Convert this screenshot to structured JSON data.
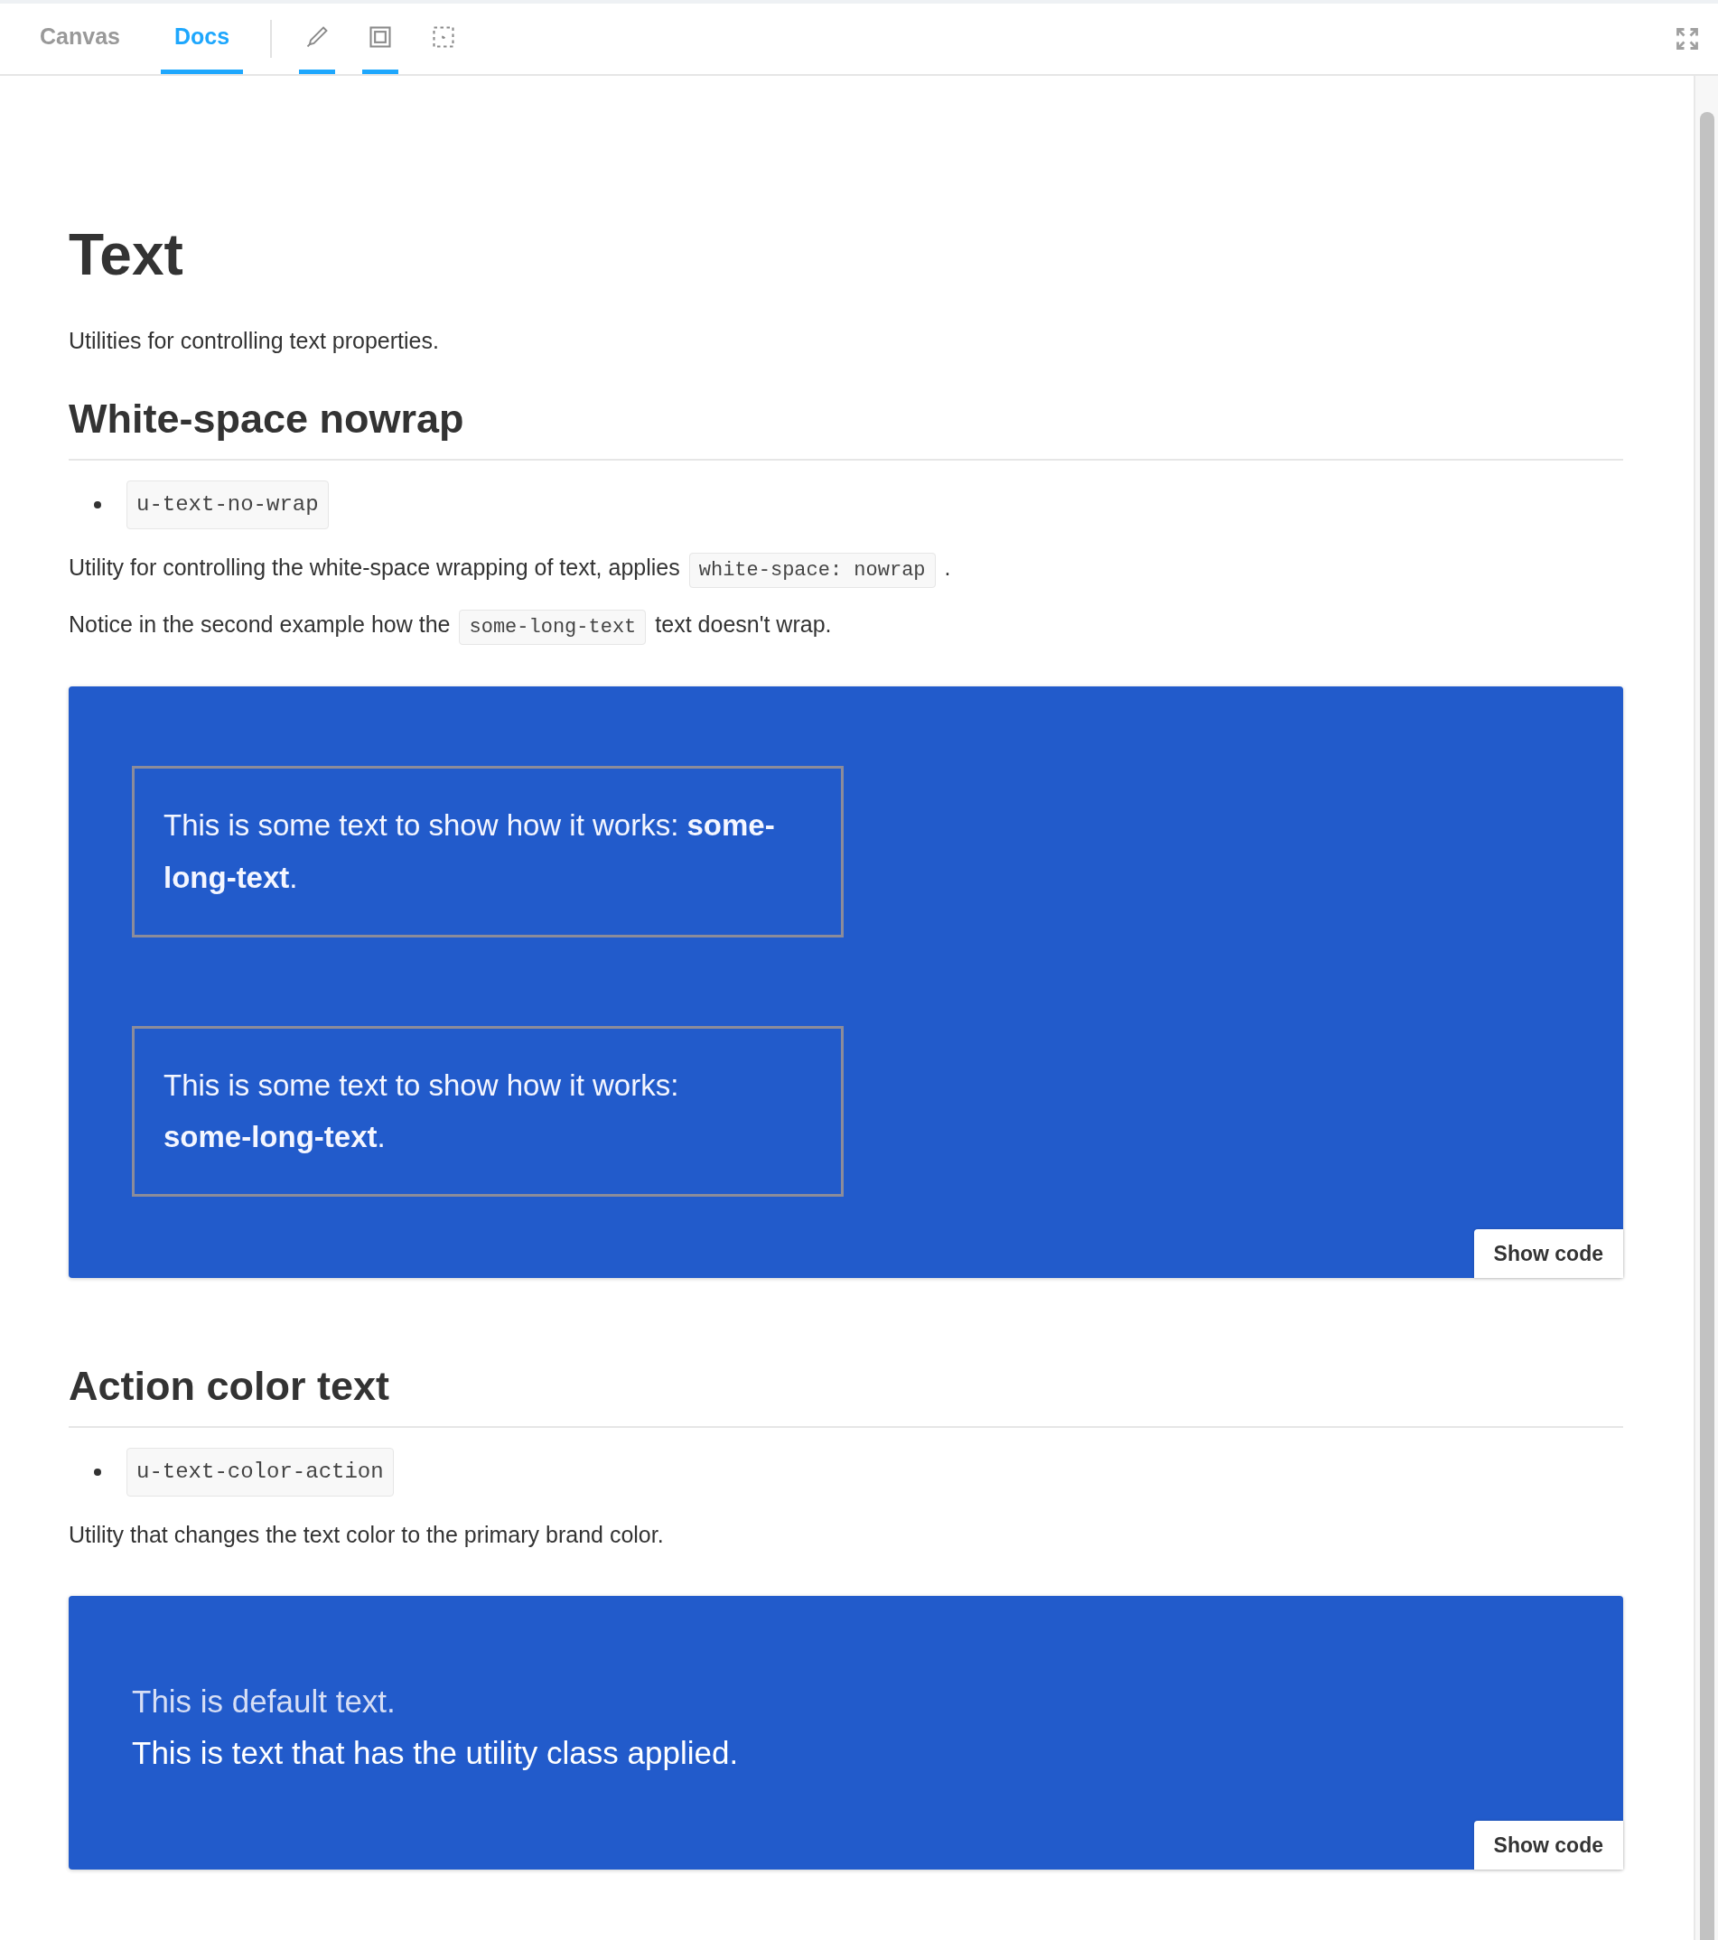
{
  "tabs": [
    {
      "label": "Canvas",
      "selected": false
    },
    {
      "label": "Docs",
      "selected": true
    }
  ],
  "tools": [
    {
      "kind": "pencil",
      "selected": true
    },
    {
      "kind": "frame",
      "selected": true
    },
    {
      "kind": "outline",
      "selected": false
    }
  ],
  "title": "Text",
  "intro": "Utilities for controlling text properties.",
  "sections": [
    {
      "heading": "White-space nowrap",
      "bullets": [
        "u-text-no-wrap"
      ],
      "paragraphs": [
        [
          {
            "kind": "text",
            "text": "Utility for controlling the white-space wrapping of text, applies"
          },
          {
            "kind": "code",
            "text": "white-space: nowrap"
          },
          {
            "kind": "text",
            "text": "."
          }
        ],
        [
          {
            "kind": "text",
            "text": "Notice in the second example how the"
          },
          {
            "kind": "code",
            "text": "some-long-text"
          },
          {
            "kind": "text",
            "text": "text doesn't wrap."
          }
        ]
      ],
      "example": {
        "kind": "boxes",
        "button": "Show code",
        "items": [
          {
            "text": "This is some text to show how it works: **some-long-text**.",
            "nowrap": false
          },
          {
            "text": "This is some text to show how it works: **some-long-text**.",
            "nowrap": true
          }
        ]
      }
    },
    {
      "heading": "Action color text",
      "bullets": [
        "u-text-color-action"
      ],
      "paragraphs": [
        [
          {
            "kind": "text",
            "text": "Utility that changes the text color to the primary brand color."
          }
        ]
      ],
      "example": {
        "kind": "lines",
        "button": "Show code",
        "items": [
          {
            "text": "This is default text.",
            "action": false
          },
          {
            "text": "This is text that has the utility class applied.",
            "action": true
          }
        ]
      }
    }
  ]
}
